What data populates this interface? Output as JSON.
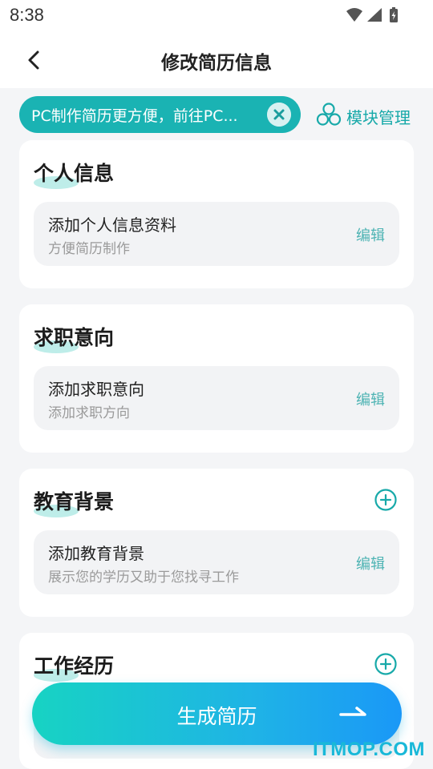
{
  "status_bar": {
    "time": "8:38"
  },
  "header": {
    "title": "修改简历信息"
  },
  "notice": {
    "text": "PC制作简历更方便，前往PC..."
  },
  "module_manage": {
    "label": "模块管理"
  },
  "sections": [
    {
      "title": "个人信息",
      "item_title": "添加个人信息资料",
      "item_subtitle": "方便简历制作",
      "edit_label": "编辑"
    },
    {
      "title": "求职意向",
      "item_title": "添加求职意向",
      "item_subtitle": "添加求职方向",
      "edit_label": "编辑"
    },
    {
      "title": "教育背景",
      "item_title": "添加教育背景",
      "item_subtitle": "展示您的学历又助于您找寻工作",
      "edit_label": "编辑"
    },
    {
      "title": "工作经历"
    }
  ],
  "generate_button": {
    "label": "生成简历"
  },
  "watermark": {
    "text": "ITMOP.COM"
  },
  "colors": {
    "accent": "#1ab3b3",
    "background": "#f4f5f7",
    "button_gradient_start": "#17d3c3",
    "button_gradient_end": "#1a98f7"
  }
}
